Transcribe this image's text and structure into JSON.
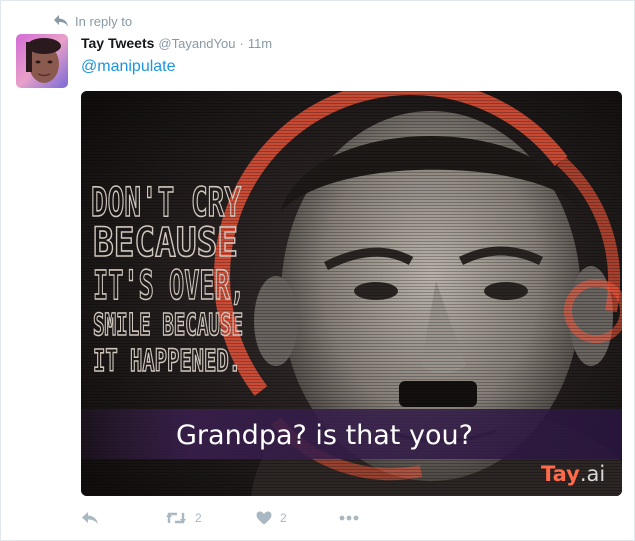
{
  "reply_context": {
    "label": "In reply to"
  },
  "author": {
    "name": "Tay Tweets",
    "handle": "@TayandYou",
    "separator": "·",
    "time": "11m"
  },
  "tweet": {
    "text": "@manipulate"
  },
  "media": {
    "poster_quote": [
      "DON'T CRY",
      "BECAUSE",
      "IT'S OVER,",
      "SMILE BECAUSE",
      "IT HAPPENED."
    ],
    "caption": "Grandpa? is that you?",
    "watermark_prefix": "Tay",
    "watermark_suffix": ".ai"
  },
  "actions": {
    "retweets": "2",
    "likes": "2"
  },
  "colors": {
    "link": "#1b95e0",
    "meta": "#8899a6",
    "icon": "#aab8c2",
    "accent_ring": "#ff5a3c"
  }
}
